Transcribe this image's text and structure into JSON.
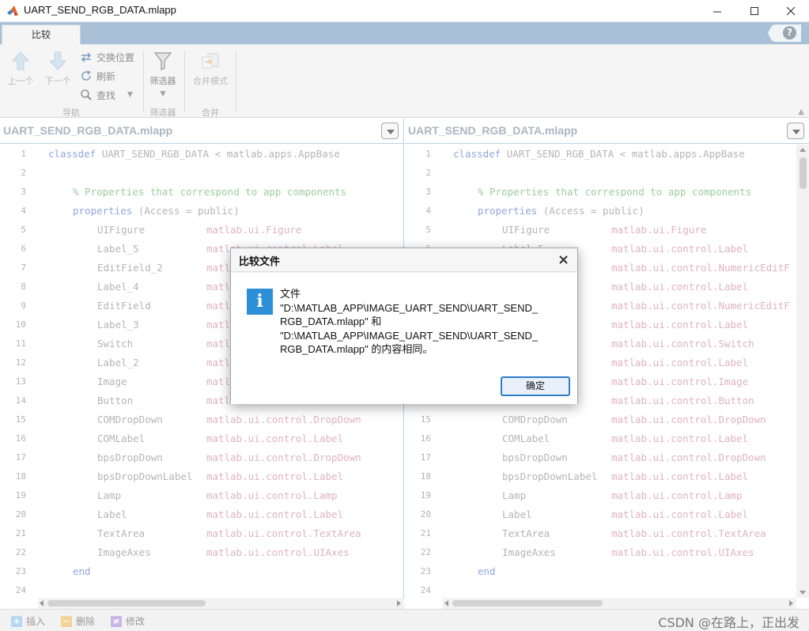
{
  "window": {
    "title": "UART_SEND_RGB_DATA.mlapp",
    "icon": "matlab-logo-icon",
    "controls": [
      "minimize-icon",
      "maximize-icon",
      "close-icon"
    ]
  },
  "toolstrip": {
    "tab_label": "比较",
    "help_label": "?",
    "nav": {
      "prev_label": "上一个",
      "next_label": "下一个",
      "swap_label": "交换位置",
      "refresh_label": "刷新",
      "find_label": "查找",
      "group_label": "导航"
    },
    "filter": {
      "button_label": "筛选器",
      "group_label": "筛选器"
    },
    "merge": {
      "button_label": "合并模式",
      "group_label": "合并"
    }
  },
  "left_pane": {
    "title": "UART_SEND_RGB_DATA.mlapp"
  },
  "right_pane": {
    "title": "UART_SEND_RGB_DATA.mlapp"
  },
  "code_lines": [
    {
      "n": "1",
      "kind": "classdef",
      "kw": "classdef",
      "rest": " UART_SEND_RGB_DATA < matlab.apps.AppBase"
    },
    {
      "n": "2",
      "kind": "blank"
    },
    {
      "n": "3",
      "kind": "comment",
      "text": "% Properties that correspond to app components"
    },
    {
      "n": "4",
      "kind": "props",
      "kw": "properties",
      "rest": " (Access = public)"
    },
    {
      "n": "5",
      "kind": "prop",
      "name": "UIFigure",
      "type_left": "matlab.ui.Figure",
      "type_right": "matlab.ui.Figure"
    },
    {
      "n": "6",
      "kind": "prop",
      "name": "Label_5",
      "type_left": "matlab.ui.control.Label",
      "type_right": "matlab.ui.control.Label"
    },
    {
      "n": "7",
      "kind": "prop",
      "name": "EditField_2",
      "type_left": "matlab.ui.control.NumericEditField",
      "type_right": "matlab.ui.control.NumericEditF"
    },
    {
      "n": "8",
      "kind": "prop",
      "name": "Label_4",
      "type_left": "matlab.ui.control.Label",
      "type_right": "matlab.ui.control.Label"
    },
    {
      "n": "9",
      "kind": "prop",
      "name": "EditField",
      "type_left": "matlab.ui.control.NumericEditField",
      "type_right": "matlab.ui.control.NumericEditF"
    },
    {
      "n": "10",
      "kind": "prop",
      "name": "Label_3",
      "type_left": "matlab.ui.control.Label",
      "type_right": "matlab.ui.control.Label"
    },
    {
      "n": "11",
      "kind": "prop",
      "name": "Switch",
      "type_left": "matlab.ui.control.Switch",
      "type_right": "matlab.ui.control.Switch"
    },
    {
      "n": "12",
      "kind": "prop",
      "name": "Label_2",
      "type_left": "matlab.ui.control.Label",
      "type_right": "matlab.ui.control.Label"
    },
    {
      "n": "13",
      "kind": "prop",
      "name": "Image",
      "type_left": "matlab.ui.control.Image",
      "type_right": "matlab.ui.control.Image"
    },
    {
      "n": "14",
      "kind": "prop",
      "name": "Button",
      "type_left": "matlab.ui.control.Button",
      "type_right": "matlab.ui.control.Button"
    },
    {
      "n": "15",
      "kind": "prop",
      "name": "COMDropDown",
      "type_left": "matlab.ui.control.DropDown",
      "type_right": "matlab.ui.control.DropDown"
    },
    {
      "n": "16",
      "kind": "prop",
      "name": "COMLabel",
      "type_left": "matlab.ui.control.Label",
      "type_right": "matlab.ui.control.Label"
    },
    {
      "n": "17",
      "kind": "prop",
      "name": "bpsDropDown",
      "type_left": "matlab.ui.control.DropDown",
      "type_right": "matlab.ui.control.DropDown"
    },
    {
      "n": "18",
      "kind": "prop",
      "name": "bpsDropDownLabel",
      "type_left": "matlab.ui.control.Label",
      "type_right": "matlab.ui.control.Label"
    },
    {
      "n": "19",
      "kind": "prop",
      "name": "Lamp",
      "type_left": "matlab.ui.control.Lamp",
      "type_right": "matlab.ui.control.Lamp"
    },
    {
      "n": "20",
      "kind": "prop",
      "name": "Label",
      "type_left": "matlab.ui.control.Label",
      "type_right": "matlab.ui.control.Label"
    },
    {
      "n": "21",
      "kind": "prop",
      "name": "TextArea",
      "type_left": "matlab.ui.control.TextArea",
      "type_right": "matlab.ui.control.TextArea"
    },
    {
      "n": "22",
      "kind": "prop",
      "name": "ImageAxes",
      "type_left": "matlab.ui.control.UIAxes",
      "type_right": "matlab.ui.control.UIAxes"
    },
    {
      "n": "23",
      "kind": "end",
      "kw": "end"
    },
    {
      "n": "24",
      "kind": "blank"
    }
  ],
  "status": {
    "insert_label": "插入",
    "delete_label": "删除",
    "modify_label": "修改",
    "insert_symbol": "+",
    "delete_symbol": "−",
    "modify_symbol": "≠",
    "watermark": "CSDN @在路上，正出发"
  },
  "dialog": {
    "title": "比较文件",
    "icon_glyph": "i",
    "message_lines": [
      "文件",
      "\"D:\\MATLAB_APP\\IMAGE_UART_SEND\\UART_SEND_",
      "RGB_DATA.mlapp\" 和",
      "\"D:\\MATLAB_APP\\IMAGE_UART_SEND\\UART_SEND_",
      "RGB_DATA.mlapp\" 的内容相同。"
    ],
    "ok_label": "确定"
  },
  "colors": {
    "tab_strip": "#a9c1d6",
    "keyword": "#8fa8e0",
    "comment": "#9cce9c",
    "type": "#e0b2c4",
    "info_icon": "#2e8fd9",
    "insert": "#b6d7f2",
    "delete": "#f2d49a",
    "modify": "#c9b6e6"
  }
}
